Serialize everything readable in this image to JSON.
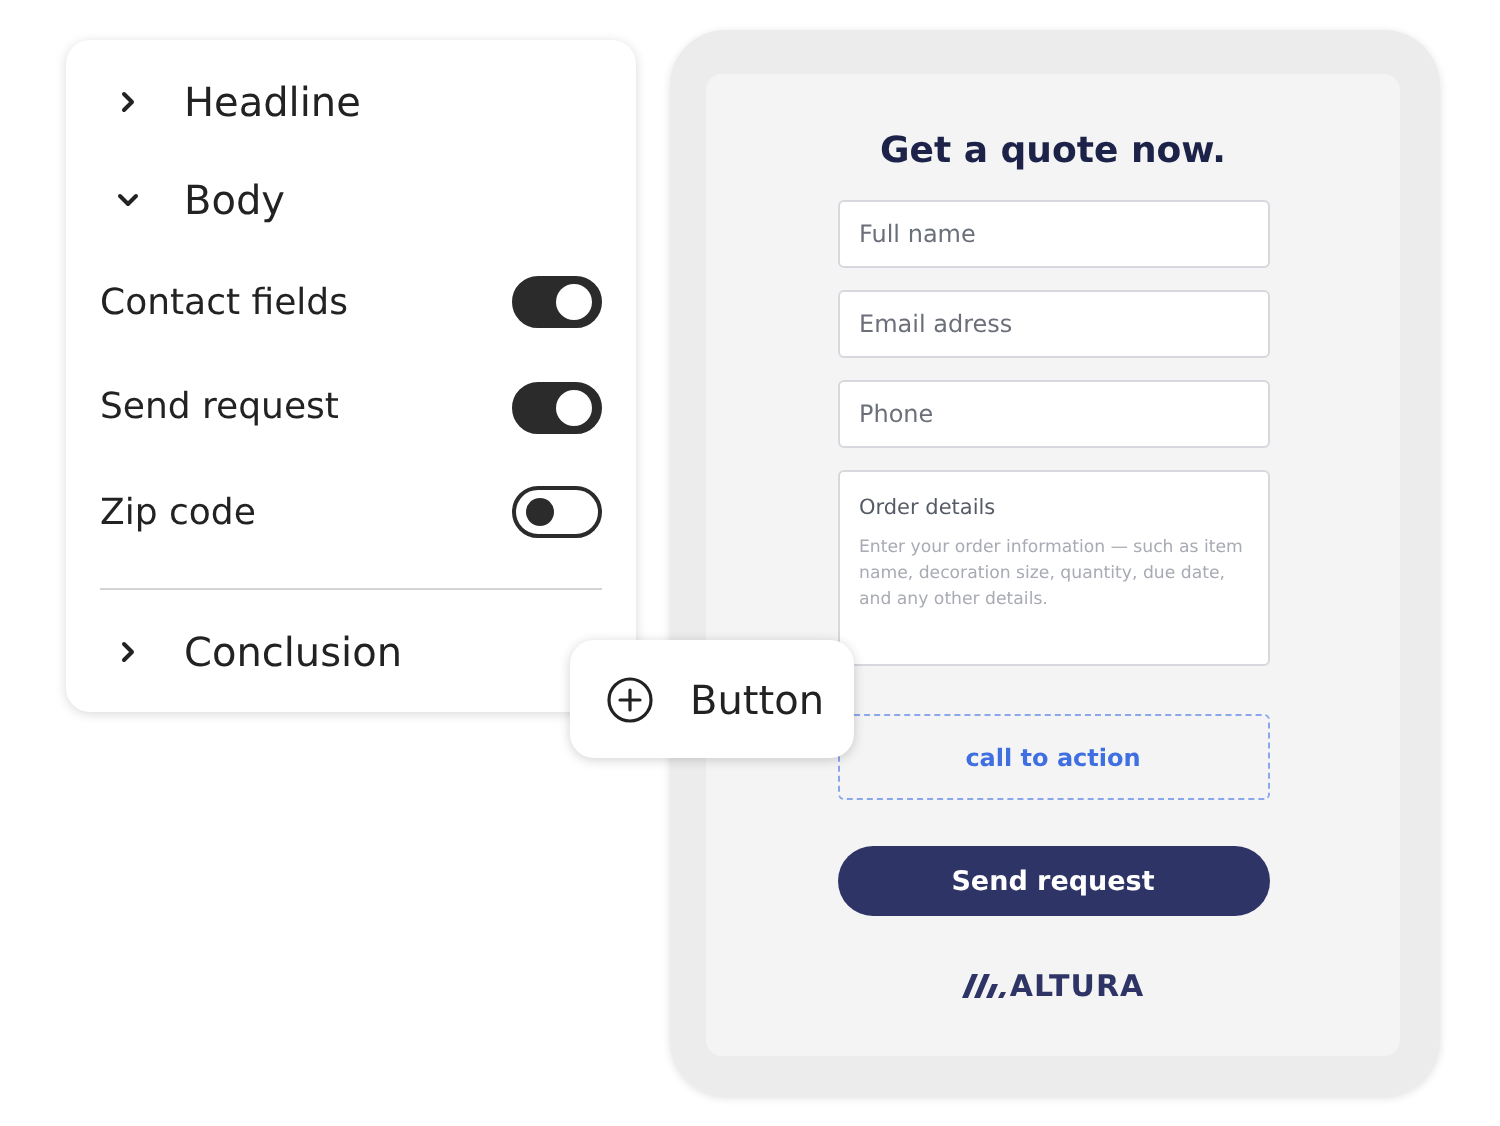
{
  "panel": {
    "sections": [
      {
        "label": "Headline",
        "expanded": false
      },
      {
        "label": "Body",
        "expanded": true,
        "children": [
          {
            "label": "Contact fields",
            "on": true
          },
          {
            "label": "Send request",
            "on": true
          },
          {
            "label": "Zip code",
            "on": false
          }
        ]
      },
      {
        "label": "Conclusion",
        "expanded": false
      }
    ]
  },
  "add_button": {
    "label": "Button"
  },
  "form": {
    "title": "Get a quote now.",
    "fields": [
      {
        "kind": "input",
        "placeholder": "Full name"
      },
      {
        "kind": "input",
        "placeholder": "Email adress"
      },
      {
        "kind": "input",
        "placeholder": "Phone"
      },
      {
        "kind": "textarea",
        "label": "Order details",
        "placeholder": "Enter your order information — such as item name, decoration size, quantity, due date, and any other details."
      }
    ],
    "drop_zone": "call to action",
    "submit": "Send request",
    "logo": "ALTURA"
  }
}
